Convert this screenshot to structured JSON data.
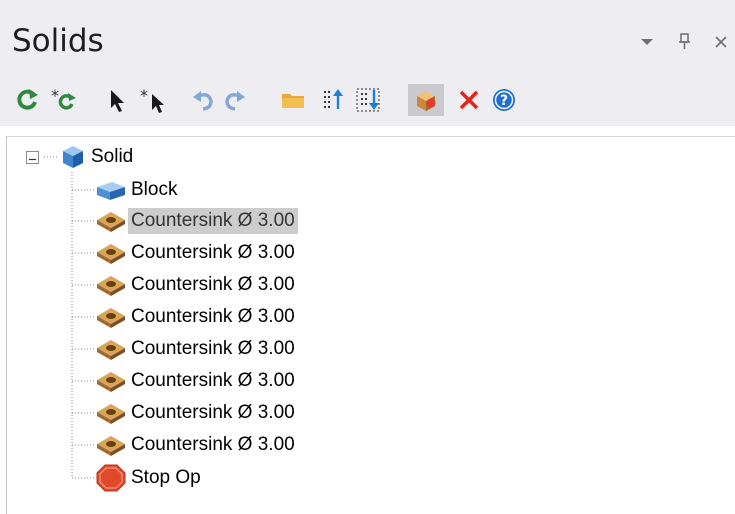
{
  "panel": {
    "title": "Solids",
    "header_buttons": [
      "dropdown-icon",
      "pin-icon",
      "close-icon"
    ]
  },
  "toolbar": {
    "buttons": [
      {
        "name": "regenerate-icon"
      },
      {
        "name": "regenerate-all-icon"
      },
      {
        "name": "select-icon"
      },
      {
        "name": "select-all-icon"
      },
      {
        "name": "undo-icon"
      },
      {
        "name": "redo-icon"
      },
      {
        "name": "folder-icon"
      },
      {
        "name": "move-up-icon"
      },
      {
        "name": "move-down-icon"
      },
      {
        "name": "solid-view-icon",
        "active": true
      },
      {
        "name": "delete-icon"
      },
      {
        "name": "help-icon"
      }
    ]
  },
  "tree": {
    "root": {
      "label": "Solid",
      "icon": "solid-cube-icon",
      "expanded": true
    },
    "children": [
      {
        "label": "Block",
        "icon": "block-icon"
      },
      {
        "label": "Countersink Ø 3.00",
        "icon": "countersink-icon",
        "selected": true
      },
      {
        "label": "Countersink Ø 3.00",
        "icon": "countersink-icon"
      },
      {
        "label": "Countersink Ø 3.00",
        "icon": "countersink-icon"
      },
      {
        "label": "Countersink Ø 3.00",
        "icon": "countersink-icon"
      },
      {
        "label": "Countersink Ø 3.00",
        "icon": "countersink-icon"
      },
      {
        "label": "Countersink Ø 3.00",
        "icon": "countersink-icon"
      },
      {
        "label": "Countersink Ø 3.00",
        "icon": "countersink-icon"
      },
      {
        "label": "Countersink Ø 3.00",
        "icon": "countersink-icon"
      },
      {
        "label": "Stop Op",
        "icon": "stop-op-icon"
      }
    ]
  }
}
